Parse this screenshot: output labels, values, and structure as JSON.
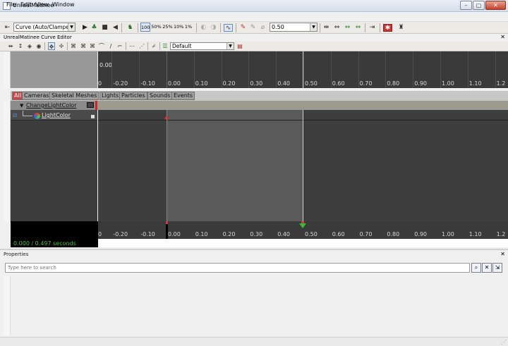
{
  "window": {
    "title": "UnrealMatinee",
    "min_glyph": "–",
    "max_glyph": "▢",
    "close_glyph": "✕"
  },
  "menu": [
    "File",
    "Edit",
    "View",
    "Window"
  ],
  "toolbar": {
    "curve_mode": "Curve (Auto/Clampec",
    "speed_options": [
      "100",
      "50%",
      "25%",
      "10%",
      "1%"
    ],
    "snap_value": "0.50",
    "icons": [
      "add-key-icon",
      "play-icon",
      "loop-icon",
      "stop-icon",
      "reverse-icon",
      "camera-icon",
      "speed-icon",
      "undo-icon",
      "redo-icon",
      "curve-editor-icon",
      "snap-icon",
      "snap-time-icon",
      "snap-frames-icon",
      "fit-sequence-icon",
      "fit-view-icon",
      "fit-loop-icon",
      "fit-loop-seq-icon",
      "end-sequence-icon",
      "record-icon",
      "director-icon"
    ]
  },
  "curve_editor": {
    "label": "UnrealMatinee Curve Editor",
    "preset": "Default",
    "zero_label": "0.00",
    "close_glyph": "✕"
  },
  "timeline": {
    "ticks": [
      "0",
      "-0.20",
      "-0.10",
      "0.00",
      "0.10",
      "0.20",
      "0.30",
      "0.40",
      "0.50",
      "0.60",
      "0.70",
      "0.80",
      "0.90",
      "1.00",
      "1.10",
      "1.2"
    ],
    "selection_start": 0.0,
    "selection_end": 0.497,
    "time_readout": "0.000 / 0.497 seconds"
  },
  "tabs": [
    "All",
    "Cameras",
    "Skeletal Meshes",
    "Lights",
    "Particles",
    "Sounds",
    "Events"
  ],
  "active_tab": "All",
  "group": {
    "name": "ChangeLightColor"
  },
  "track": {
    "name": "LightColor"
  },
  "properties": {
    "label": "Properties",
    "search_placeholder": "Type here to search",
    "close_glyph": "✕"
  }
}
